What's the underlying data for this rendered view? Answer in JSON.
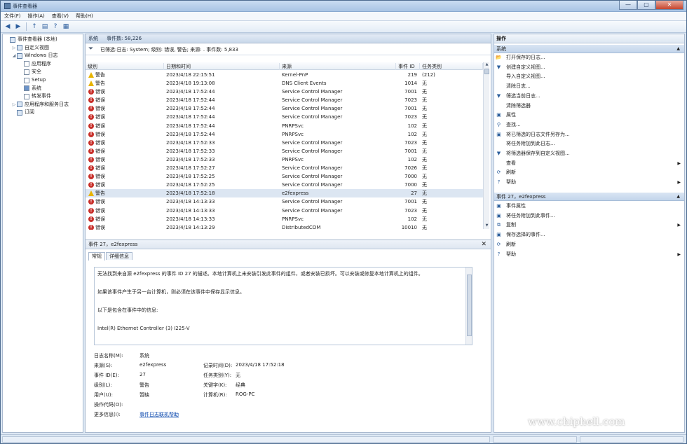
{
  "window": {
    "title": "事件查看器",
    "min": "—",
    "max": "▢",
    "close": "✕"
  },
  "menu": [
    "文件(F)",
    "操作(A)",
    "查看(V)",
    "帮助(H)"
  ],
  "toolbar": {
    "back": "◀",
    "forward": "▶",
    "up": "↑",
    "show_tree": "▤",
    "help": "?",
    "show_action": "▦"
  },
  "tree": [
    {
      "label": "事件查看器 (本地)",
      "level": 0,
      "arrow": "",
      "icon": "event-viewer-icon"
    },
    {
      "label": "自定义视图",
      "level": 1,
      "arrow": "▷",
      "icon": "folder-icon"
    },
    {
      "label": "Windows 日志",
      "level": 1,
      "arrow": "◢",
      "icon": "folder-icon"
    },
    {
      "label": "应用程序",
      "level": 2,
      "arrow": "",
      "icon": "log-icon"
    },
    {
      "label": "安全",
      "level": 2,
      "arrow": "",
      "icon": "log-icon"
    },
    {
      "label": "Setup",
      "level": 2,
      "arrow": "",
      "icon": "log-icon"
    },
    {
      "label": "系统",
      "level": 2,
      "arrow": "",
      "icon": "log-icon"
    },
    {
      "label": "转发事件",
      "level": 2,
      "arrow": "",
      "icon": "log-icon"
    },
    {
      "label": "应用程序和服务日志",
      "level": 1,
      "arrow": "▷",
      "icon": "folder-icon"
    },
    {
      "label": "订阅",
      "level": 1,
      "arrow": "",
      "icon": "subscription-icon"
    }
  ],
  "center": {
    "log_name": "系统",
    "event_count": "事件数: 58,226",
    "filter_text": "已筛选:日志: System; 级别: 错误, 警告; 来源: . 事件数: 5,833",
    "columns": [
      "级别",
      "日期和时间",
      "来源",
      "事件 ID",
      "任务类别"
    ],
    "rows": [
      {
        "level": "警告",
        "type": "warn",
        "time": "2023/4/18 22:15:51",
        "source": "Kernel-PnP",
        "id": "219",
        "task": "(212)"
      },
      {
        "level": "警告",
        "type": "warn",
        "time": "2023/4/18 19:13:08",
        "source": "DNS Client Events",
        "id": "1014",
        "task": "无"
      },
      {
        "level": "错误",
        "type": "error",
        "time": "2023/4/18 17:52:44",
        "source": "Service Control Manager",
        "id": "7001",
        "task": "无"
      },
      {
        "level": "错误",
        "type": "error",
        "time": "2023/4/18 17:52:44",
        "source": "Service Control Manager",
        "id": "7023",
        "task": "无"
      },
      {
        "level": "错误",
        "type": "error",
        "time": "2023/4/18 17:52:44",
        "source": "Service Control Manager",
        "id": "7001",
        "task": "无"
      },
      {
        "level": "错误",
        "type": "error",
        "time": "2023/4/18 17:52:44",
        "source": "Service Control Manager",
        "id": "7023",
        "task": "无"
      },
      {
        "level": "错误",
        "type": "error",
        "time": "2023/4/18 17:52:44",
        "source": "PNRPSvc",
        "id": "102",
        "task": "无"
      },
      {
        "level": "错误",
        "type": "error",
        "time": "2023/4/18 17:52:44",
        "source": "PNRPSvc",
        "id": "102",
        "task": "无"
      },
      {
        "level": "错误",
        "type": "error",
        "time": "2023/4/18 17:52:33",
        "source": "Service Control Manager",
        "id": "7023",
        "task": "无"
      },
      {
        "level": "错误",
        "type": "error",
        "time": "2023/4/18 17:52:33",
        "source": "Service Control Manager",
        "id": "7001",
        "task": "无"
      },
      {
        "level": "错误",
        "type": "error",
        "time": "2023/4/18 17:52:33",
        "source": "PNRPSvc",
        "id": "102",
        "task": "无"
      },
      {
        "level": "错误",
        "type": "error",
        "time": "2023/4/18 17:52:27",
        "source": "Service Control Manager",
        "id": "7026",
        "task": "无"
      },
      {
        "level": "错误",
        "type": "error",
        "time": "2023/4/18 17:52:25",
        "source": "Service Control Manager",
        "id": "7000",
        "task": "无"
      },
      {
        "level": "错误",
        "type": "error",
        "time": "2023/4/18 17:52:25",
        "source": "Service Control Manager",
        "id": "7000",
        "task": "无"
      },
      {
        "level": "警告",
        "type": "warn",
        "time": "2023/4/18 17:52:18",
        "source": "e2fexpress",
        "id": "27",
        "task": "无",
        "selected": true
      },
      {
        "level": "错误",
        "type": "error",
        "time": "2023/4/18 14:13:33",
        "source": "Service Control Manager",
        "id": "7001",
        "task": "无"
      },
      {
        "level": "错误",
        "type": "error",
        "time": "2023/4/18 14:13:33",
        "source": "Service Control Manager",
        "id": "7023",
        "task": "无"
      },
      {
        "level": "错误",
        "type": "error",
        "time": "2023/4/18 14:13:33",
        "source": "PNRPSvc",
        "id": "102",
        "task": "无"
      },
      {
        "level": "错误",
        "type": "error",
        "time": "2023/4/18 14:13:29",
        "source": "DistributedCOM",
        "id": "10010",
        "task": "无"
      }
    ]
  },
  "detail": {
    "title": "事件 27，e2fexpress",
    "close": "✕",
    "tabs": [
      "常规",
      "详细信息"
    ],
    "message": [
      "无法找到来自源 e2fexpress 的事件 ID 27 的描述。本地计算机上未安装引发此事件的组件，或者安装已损坏。可以安装或修复本地计算机上的组件。",
      "如果该事件产生于另一台计算机，则必须在该事件中保存显示信息。",
      "以下是包含在事件中的信息:",
      "Intel(R) Ethernet Controller (3) I225-V"
    ],
    "props": {
      "log_name_label": "日志名称(M):",
      "log_name": "系统",
      "source_label": "来源(S):",
      "source": "e2fexpress",
      "logged_label": "记录时间(D):",
      "logged": "2023/4/18 17:52:18",
      "event_id_label": "事件 ID(E):",
      "event_id": "27",
      "task_label": "任务类别(Y):",
      "task": "无",
      "level_label": "级别(L):",
      "level": "警告",
      "keywords_label": "关键字(K):",
      "keywords": "经典",
      "user_label": "用户(U):",
      "user": "暂缺",
      "computer_label": "计算机(R):",
      "computer": "ROG-PC",
      "opcode_label": "操作代码(O):",
      "opcode": "",
      "more_label": "更多信息(I):",
      "more_link": "事件日志联机帮助"
    }
  },
  "actions": {
    "title": "操作",
    "section1": "系统",
    "items1": [
      {
        "label": "打开保存的日志...",
        "icon": "open-log-icon",
        "glyph": "📂",
        "sub": false
      },
      {
        "label": "创建自定义视图...",
        "icon": "create-view-icon",
        "glyph": "▼",
        "sub": false
      },
      {
        "label": "导入自定义视图...",
        "icon": "import-view-icon",
        "glyph": "",
        "sub": false
      },
      {
        "label": "清除日志...",
        "icon": "",
        "glyph": "",
        "sub": false
      },
      {
        "label": "筛选当前日志...",
        "icon": "filter-icon",
        "glyph": "▼",
        "sub": false
      },
      {
        "label": "清除筛选器",
        "icon": "",
        "glyph": "",
        "sub": false
      },
      {
        "label": "属性",
        "icon": "properties-icon",
        "glyph": "▣",
        "sub": false
      },
      {
        "label": "查找...",
        "icon": "find-icon",
        "glyph": "⚲",
        "sub": false
      },
      {
        "label": "将已筛选的日志文件另存为...",
        "icon": "save-icon",
        "glyph": "▣",
        "sub": false
      },
      {
        "label": "将任务附加到此日志...",
        "icon": "",
        "glyph": "",
        "sub": false
      },
      {
        "label": "将筛选器保存到自定义视图...",
        "icon": "save-filter-icon",
        "glyph": "▼",
        "sub": false
      },
      {
        "label": "查看",
        "icon": "",
        "glyph": "",
        "sub": true
      },
      {
        "label": "刷新",
        "icon": "refresh-icon",
        "glyph": "⟳",
        "sub": false
      },
      {
        "label": "帮助",
        "icon": "help-icon",
        "glyph": "?",
        "sub": true
      }
    ],
    "section2": "事件 27，e2fexpress",
    "items2": [
      {
        "label": "事件属性",
        "icon": "event-properties-icon",
        "glyph": "▣",
        "sub": false
      },
      {
        "label": "将任务附加到此事件...",
        "icon": "attach-task-icon",
        "glyph": "▣",
        "sub": false
      },
      {
        "label": "复制",
        "icon": "copy-icon",
        "glyph": "⧉",
        "sub": true
      },
      {
        "label": "保存选择的事件...",
        "icon": "save-icon",
        "glyph": "▣",
        "sub": false
      },
      {
        "label": "刷新",
        "icon": "refresh-icon",
        "glyph": "⟳",
        "sub": false
      },
      {
        "label": "帮助",
        "icon": "help-icon",
        "glyph": "?",
        "sub": true
      }
    ]
  },
  "watermark": {
    "text": "www.chiphell.com"
  }
}
